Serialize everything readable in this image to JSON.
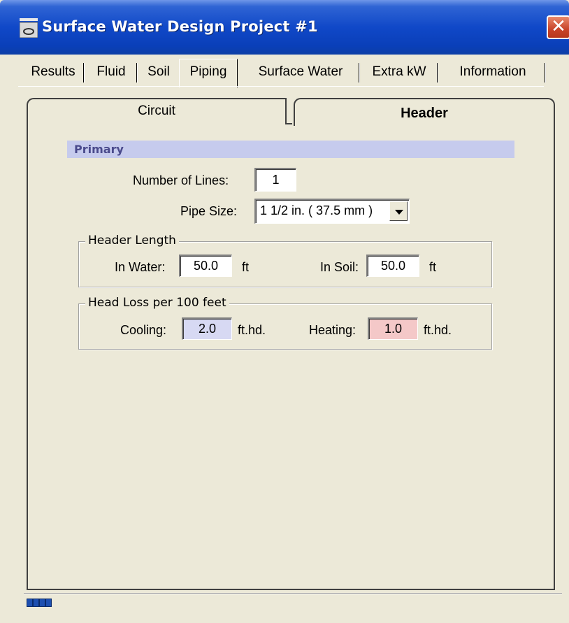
{
  "window": {
    "title": "Surface Water Design Project #1",
    "close_glyph": "✕",
    "icon": "app-icon"
  },
  "tabs": [
    {
      "label": "Results"
    },
    {
      "label": "Fluid"
    },
    {
      "label": "Soil"
    },
    {
      "label": "Piping",
      "active": true
    },
    {
      "label": "Surface Water"
    },
    {
      "label": "Extra kW"
    },
    {
      "label": "Information"
    }
  ],
  "subtabs": {
    "circuit": "Circuit",
    "header": "Header",
    "active": "header"
  },
  "primary": {
    "title": "Primary",
    "number_of_lines_label": "Number of Lines:",
    "number_of_lines_value": "1",
    "pipe_size_label": "Pipe Size:",
    "pipe_size_value": "1 1/2 in. ( 37.5 mm )"
  },
  "header_length": {
    "title": "Header Length",
    "in_water_label": "In Water:",
    "in_water_value": "50.0",
    "in_water_unit": "ft",
    "in_soil_label": "In Soil:",
    "in_soil_value": "50.0",
    "in_soil_unit": "ft"
  },
  "head_loss": {
    "title": "Head Loss per 100 feet",
    "cooling_label": "Cooling:",
    "cooling_value": "2.0",
    "cooling_unit": "ft.hd.",
    "cooling_color": "#d7d9f3",
    "heating_label": "Heating:",
    "heating_value": "1.0",
    "heating_unit": "ft.hd.",
    "heating_color": "#f4c8c8"
  },
  "colors": {
    "titlebar": "#0a3fb8",
    "primary_bar": "#c6cbed",
    "primary_text": "#4a4a8c"
  }
}
